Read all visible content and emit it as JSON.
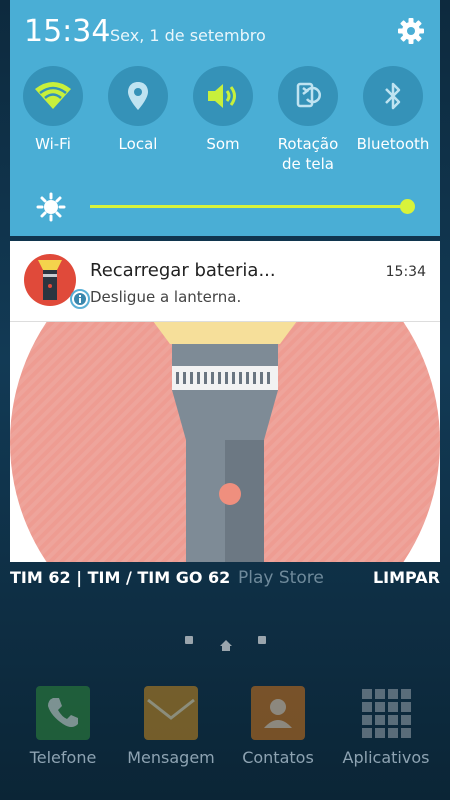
{
  "status": {
    "time": "15:34",
    "date": "Sex, 1 de setembro"
  },
  "quick_settings": {
    "toggles": [
      {
        "label": "Wi-Fi",
        "icon": "wifi-icon",
        "active": true
      },
      {
        "label": "Local",
        "icon": "location-icon",
        "active": false
      },
      {
        "label": "Som",
        "icon": "sound-icon",
        "active": true
      },
      {
        "label": "Rotação\nde tela",
        "label_line1": "Rotação",
        "label_line2": "de tela",
        "icon": "rotation-icon",
        "active": false
      },
      {
        "label": "Bluetooth",
        "icon": "bluetooth-icon",
        "active": false
      }
    ],
    "brightness": {
      "level": 1.0,
      "icon": "brightness-icon"
    }
  },
  "notification": {
    "title": "Recarregar bateria...",
    "text": "Desligue a lanterna.",
    "time": "15:34"
  },
  "footer": {
    "carrier": "TIM 62 | TIM / TIM GO 62",
    "clear_label": "LIMPAR",
    "background_label": "Play Store"
  },
  "dock": [
    {
      "label": "Telefone",
      "icon": "phone-icon"
    },
    {
      "label": "Mensagem",
      "icon": "message-icon"
    },
    {
      "label": "Contatos",
      "icon": "contacts-icon"
    },
    {
      "label": "Aplicativos",
      "icon": "apps-grid-icon"
    }
  ],
  "colors": {
    "panel": "#4aaed5",
    "toggle_active": "#c8f03c",
    "accent_slider": "#d8f33a",
    "notif_icon_bg": "#e04a3a"
  }
}
